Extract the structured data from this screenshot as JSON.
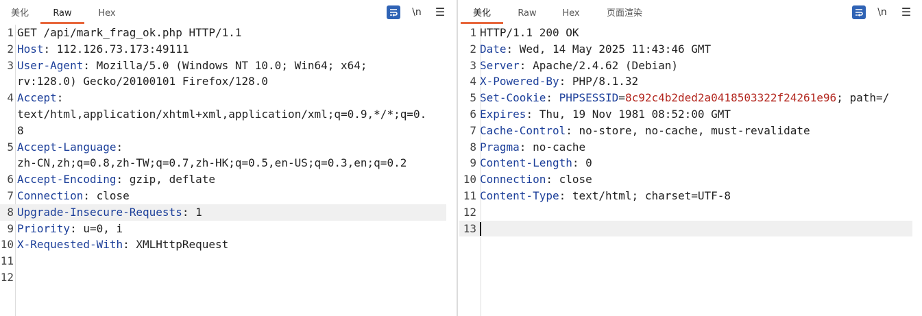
{
  "request": {
    "tabs": [
      "美化",
      "Raw",
      "Hex"
    ],
    "active_tab": "Raw",
    "newline_toggle": "\\n",
    "lines": [
      {
        "num": "1",
        "name": "",
        "sep": "",
        "value": "GET /api/mark_frag_ok.php HTTP/1.1"
      },
      {
        "num": "2",
        "name": "Host",
        "sep": ": ",
        "value": "112.126.73.173:49111"
      },
      {
        "num": "3",
        "name": "User-Agent",
        "sep": ": ",
        "value": "Mozilla/5.0 (Windows NT 10.0; Win64; x64;"
      },
      {
        "num": "",
        "name": "",
        "sep": "",
        "value": "rv:128.0) Gecko/20100101 Firefox/128.0"
      },
      {
        "num": "4",
        "name": "Accept",
        "sep": ":",
        "value": ""
      },
      {
        "num": "",
        "name": "",
        "sep": "",
        "value": "text/html,application/xhtml+xml,application/xml;q=0.9,*/*;q=0."
      },
      {
        "num": "",
        "name": "",
        "sep": "",
        "value": "8"
      },
      {
        "num": "5",
        "name": "Accept-Language",
        "sep": ":",
        "value": ""
      },
      {
        "num": "",
        "name": "",
        "sep": "",
        "value": "zh-CN,zh;q=0.8,zh-TW;q=0.7,zh-HK;q=0.5,en-US;q=0.3,en;q=0.2"
      },
      {
        "num": "6",
        "name": "Accept-Encoding",
        "sep": ": ",
        "value": "gzip, deflate"
      },
      {
        "num": "7",
        "name": "Connection",
        "sep": ": ",
        "value": "close"
      },
      {
        "num": "8",
        "name": "Upgrade-Insecure-Requests",
        "sep": ": ",
        "value": "1"
      },
      {
        "num": "9",
        "name": "Priority",
        "sep": ": ",
        "value": "u=0, i"
      },
      {
        "num": "10",
        "name": "X-Requested-With",
        "sep": ": ",
        "value": "XMLHttpRequest"
      },
      {
        "num": "11",
        "name": "",
        "sep": "",
        "value": ""
      },
      {
        "num": "12",
        "name": "",
        "sep": "",
        "value": ""
      }
    ],
    "highlighted_line": "8"
  },
  "response": {
    "tabs": [
      "美化",
      "Raw",
      "Hex",
      "页面渲染"
    ],
    "active_tab": "美化",
    "newline_toggle": "\\n",
    "lines": [
      {
        "num": "1",
        "name": "",
        "sep": "",
        "value": "HTTP/1.1 200 OK"
      },
      {
        "num": "2",
        "name": "Date",
        "sep": ": ",
        "value": "Wed, 14 May 2025 11:43:46 GMT"
      },
      {
        "num": "3",
        "name": "Server",
        "sep": ": ",
        "value": "Apache/2.4.62 (Debian)"
      },
      {
        "num": "4",
        "name": "X-Powered-By",
        "sep": ": ",
        "value": "PHP/8.1.32"
      },
      {
        "num": "5",
        "name": "Set-Cookie",
        "sep": ": ",
        "value": "",
        "cookie_name": "PHPSESSID",
        "cookie_eq": "=",
        "cookie_value": "8c92c4b2ded2a0418503322f24261e96",
        "cookie_rest": "; path=/"
      },
      {
        "num": "6",
        "name": "Expires",
        "sep": ": ",
        "value": "Thu, 19 Nov 1981 08:52:00 GMT"
      },
      {
        "num": "7",
        "name": "Cache-Control",
        "sep": ": ",
        "value": "no-store, no-cache, must-revalidate"
      },
      {
        "num": "8",
        "name": "Pragma",
        "sep": ": ",
        "value": "no-cache"
      },
      {
        "num": "9",
        "name": "Content-Length",
        "sep": ": ",
        "value": "0"
      },
      {
        "num": "10",
        "name": "Connection",
        "sep": ": ",
        "value": "close"
      },
      {
        "num": "11",
        "name": "Content-Type",
        "sep": ": ",
        "value": "text/html; charset=UTF-8"
      },
      {
        "num": "12",
        "name": "",
        "sep": "",
        "value": ""
      },
      {
        "num": "13",
        "name": "",
        "sep": "",
        "value": ""
      }
    ],
    "cursor_line": "13"
  },
  "icons": {
    "wrap": "word-wrap-icon",
    "newline": "newline-toggle-icon",
    "menu": "hamburger-menu-icon"
  },
  "colors": {
    "accent": "#e8673c",
    "header_name": "#1c3f9a",
    "cookie_value": "#b3261e",
    "button_blue": "#2f63b5"
  }
}
